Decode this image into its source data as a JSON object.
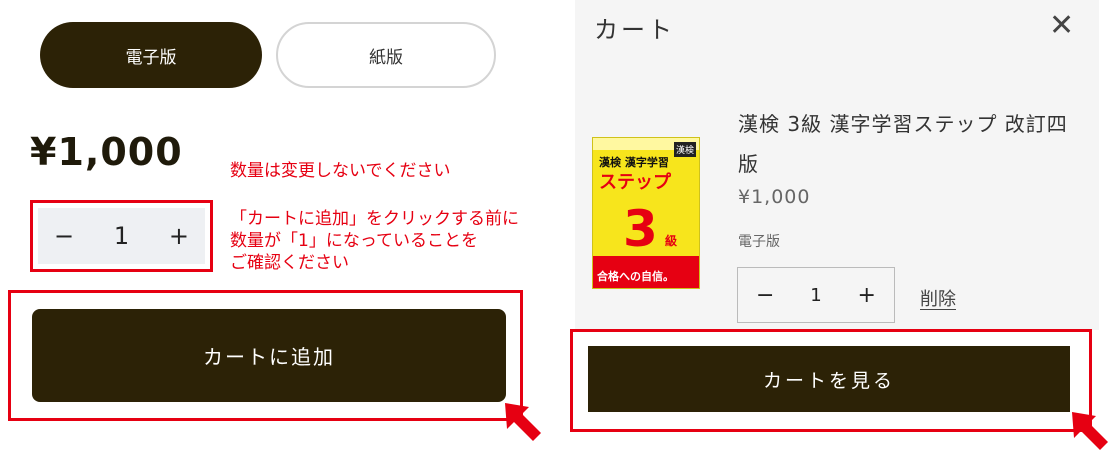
{
  "product": {
    "format_ebook": "電子版",
    "format_paper": "紙版",
    "price": "¥1,000",
    "qty_minus": "−",
    "qty_value": "1",
    "qty_plus": "+",
    "add_to_cart": "カートに追加"
  },
  "notes": {
    "note1": "数量は変更しないでください",
    "note2_line1": "「カートに追加」をクリックする前に",
    "note2_line2": "数量が「1」になっていることを",
    "note2_line3": "ご確認ください"
  },
  "drawer": {
    "title": "カート",
    "close": "✕",
    "item_title": "漢検 3級 漢字学習ステップ 改訂四版",
    "item_price": "¥1,000",
    "item_format": "電子版",
    "qty_minus": "−",
    "qty_value": "1",
    "qty_plus": "+",
    "delete": "削除",
    "view_cart": "カートを見る"
  },
  "cover": {
    "kanken": "漢検",
    "line1": "漢検 漢字学習",
    "line2": "ステップ",
    "grade": "3",
    "kyu": "級",
    "band_text": "合格への自信。"
  },
  "colors": {
    "accent_dark": "#2c2206",
    "highlight_red": "#e60012"
  },
  "icons": {
    "close": "close-icon",
    "pointer": "pointer-arrow-icon"
  }
}
